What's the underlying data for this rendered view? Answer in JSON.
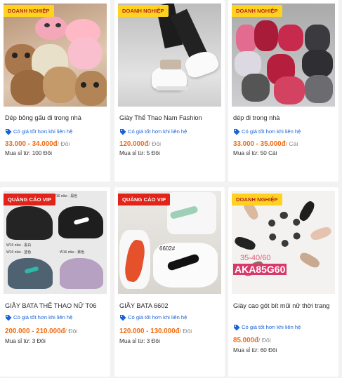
{
  "products": [
    {
      "badge": "DOANH NGHIỆP",
      "badge_type": "biz",
      "title": "Dép bông gấu đi trong nhà",
      "promo": "Có giá tốt hơn khi liên hệ",
      "price": "33.000 - 34.000đ",
      "unit": "/ Đôi",
      "min_buy": "Mua sỉ từ: 100 Đôi"
    },
    {
      "badge": "DOANH NGHIỆP",
      "badge_type": "biz",
      "title": "Giày Thể Thao Nam Fashion",
      "promo": "Có giá tốt hơn khi liên hệ",
      "price": "120.000đ",
      "unit": "/ Đôi",
      "min_buy": "Mua sỉ từ: 5 Đôi"
    },
    {
      "badge": "DOANH NGHIỆP",
      "badge_type": "biz",
      "title": "dép đi trong nhà",
      "promo": "Có giá tốt hơn khi liên hệ",
      "price": "33.000 - 35.000đ",
      "unit": "/ Cái",
      "min_buy": "Mua sỉ từ: 50 Cái"
    },
    {
      "badge": "QUẢNG CÁO VIP",
      "badge_type": "vip",
      "title": "GIẦY BATA THỂ THAO NỮ T06",
      "promo": "Có giá tốt hơn khi liên hệ",
      "price": "200.000 - 210.000đ",
      "unit": "/ Đôi",
      "min_buy": "Mua sỉ từ: 3 Đôi",
      "photo_texts": [
        "W16 nike - 黑色",
        "W16 nike - 黑白",
        "W16 nike - 蓝色",
        "W16 nike - 紫色"
      ]
    },
    {
      "badge": "QUẢNG CÁO VIP",
      "badge_type": "vip",
      "title": "GIẦY BATA 6602",
      "promo": "Có giá tốt hơn khi liên hệ",
      "price": "120.000 - 130.000đ",
      "unit": "/ Đôi",
      "min_buy": "Mua sỉ từ: 3 Đôi",
      "photo_texts": [
        "6602#"
      ]
    },
    {
      "badge": "DOANH NGHIỆP",
      "badge_type": "biz",
      "title": "Giày cao gót bít mũi nữ thời trang",
      "promo": "Có giá tốt hơn khi liên hệ",
      "price": "85.000đ",
      "unit": "/ Đôi",
      "min_buy": "Mua sỉ từ: 60 Đôi",
      "photo_texts": [
        "35-40/60",
        "AKA85G60"
      ]
    }
  ],
  "colors": {
    "price": "#f36a0f",
    "promo": "#1a62d6",
    "biz_badge_bg": "#ffd21f",
    "biz_badge_fg": "#b3261e",
    "vip_badge_bg": "#e2231a"
  },
  "icons": {
    "promo": "price-tag-icon"
  }
}
